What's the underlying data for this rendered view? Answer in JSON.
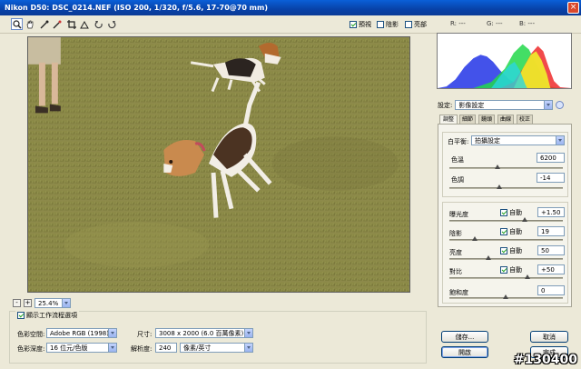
{
  "window": {
    "title": "Nikon D50:  DSC_0214.NEF  (ISO 200, 1/320, f/5.6, 17-70@70 mm)",
    "close_glyph": "×"
  },
  "toolbar": {
    "tools": [
      "zoom-tool",
      "hand-tool",
      "white-balance-tool",
      "color-sampler-tool",
      "crop-tool",
      "straighten-tool",
      "rotate-left-tool",
      "rotate-right-tool"
    ],
    "preview_label": "預視",
    "shadows_label": "陰影",
    "highlights_label": "亮部",
    "preview_checked": true,
    "shadows_checked": false,
    "highlights_checked": false
  },
  "readout": {
    "r": "R: ---",
    "g": "G: ---",
    "b": "B: ---"
  },
  "zoom": {
    "minus": "-",
    "plus": "+",
    "level": "25.4%"
  },
  "workflow": {
    "header": "顯示工作流程選項",
    "checked": true,
    "space_label": "色彩空間:",
    "space_value": "Adobe RGB (1998)",
    "depth_label": "色彩深度:",
    "depth_value": "16 位元/色版",
    "size_label": "尺寸:",
    "size_value": "3008 x 2000 (6.0 百萬像素)",
    "res_label": "解析度:",
    "res_value": "240",
    "res_unit": "像素/英寸"
  },
  "settings": {
    "label": "設定:",
    "value": "影像設定"
  },
  "tabs": [
    "調整",
    "細節",
    "鏡頭",
    "曲線",
    "校正"
  ],
  "adjust": {
    "wb_label": "白平衡:",
    "wb_value": "拍攝設定",
    "temp_label": "色溫",
    "temp_value": "6200",
    "tint_label": "色調",
    "tint_value": "-14",
    "exposure_label": "曝光度",
    "exposure_value": "+1.50",
    "shadows_label": "陰影",
    "shadows_value": "19",
    "brightness_label": "亮度",
    "brightness_value": "50",
    "contrast_label": "對比",
    "contrast_value": "+50",
    "saturation_label": "飽和度",
    "saturation_value": "0",
    "auto_label": "自動"
  },
  "buttons": {
    "save": "儲存...",
    "open": "開啟",
    "cancel": "取消",
    "done": "完成"
  },
  "watermark": "#130400",
  "colors": {
    "title_blue": "#0a4fc8",
    "panel_bg": "#ece9d8",
    "grass": "#8a8a42"
  }
}
